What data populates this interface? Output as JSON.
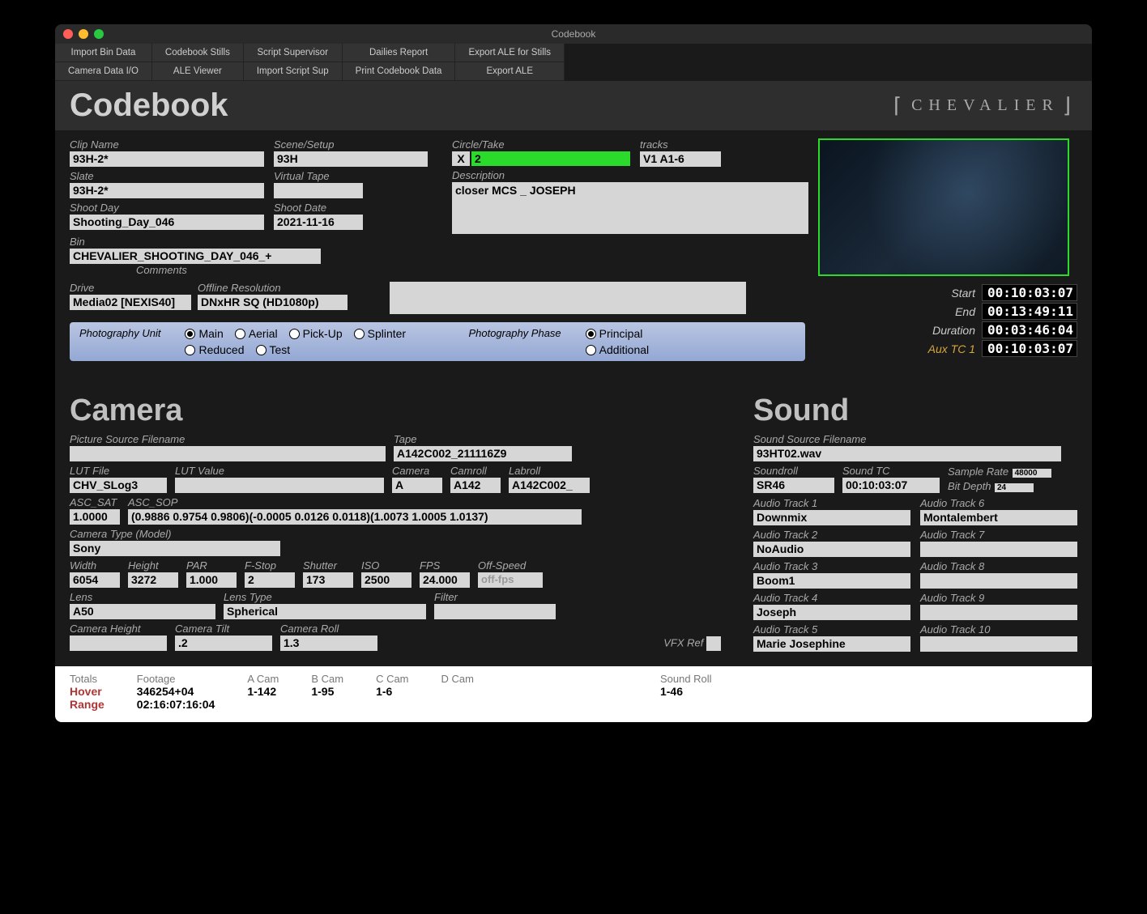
{
  "window": {
    "title": "Codebook"
  },
  "toolbar": {
    "r1c1": "Import Bin Data",
    "r2c1": "Camera Data I/O",
    "r1c2": "Codebook Stills",
    "r2c2": "ALE Viewer",
    "r1c3": "Script Supervisor",
    "r2c3": "Import Script Sup",
    "r1c4": "Dailies Report",
    "r2c4": "Print Codebook Data",
    "r1c5": "Export ALE for Stills",
    "r2c5": "Export ALE"
  },
  "header": {
    "title": "Codebook",
    "brand": "CHEVALIER"
  },
  "clip": {
    "clip_name_lbl": "Clip Name",
    "clip_name": "93H-2*",
    "slate_lbl": "Slate",
    "slate": "93H-2*",
    "shoot_day_lbl": "Shoot Day",
    "shoot_day": "Shooting_Day_046",
    "bin_lbl": "Bin",
    "bin": "CHEVALIER_SHOOTING_DAY_046_+",
    "drive_lbl": "Drive",
    "drive": "Media02 [NEXIS40]",
    "offline_res_lbl": "Offline Resolution",
    "offline_res": "DNxHR SQ (HD1080p)",
    "scene_lbl": "Scene/Setup",
    "scene": "93H",
    "vtape_lbl": "Virtual Tape",
    "vtape": "",
    "shoot_date_lbl": "Shoot Date",
    "shoot_date": "2021-11-16",
    "circle_lbl": "Circle/Take",
    "circle_x": "X",
    "circle_take": "2",
    "desc_lbl": "Description",
    "desc": "closer MCS _ JOSEPH",
    "comments_lbl": "Comments",
    "tracks_lbl": "tracks",
    "tracks": "V1 A1-6"
  },
  "radios": {
    "unit_lbl": "Photography Unit",
    "main": "Main",
    "aerial": "Aerial",
    "pickup": "Pick-Up",
    "splinter": "Splinter",
    "reduced": "Reduced",
    "test": "Test",
    "phase_lbl": "Photography Phase",
    "principal": "Principal",
    "additional": "Additional"
  },
  "tc": {
    "start_lbl": "Start",
    "start": "00:10:03:07",
    "end_lbl": "End",
    "end": "00:13:49:11",
    "dur_lbl": "Duration",
    "dur": "00:03:46:04",
    "aux_lbl": "Aux TC 1",
    "aux": "00:10:03:07"
  },
  "camera": {
    "title": "Camera",
    "psf_lbl": "Picture Source Filename",
    "psf": "",
    "lut_lbl": "LUT File",
    "lut": "CHV_SLog3",
    "lutv_lbl": "LUT Value",
    "lutv": "",
    "asat_lbl": "ASC_SAT",
    "asat": "1.0000",
    "asop_lbl": "ASC_SOP",
    "asop": "(0.9886 0.9754 0.9806)(-0.0005 0.0126 0.0118)(1.0073 1.0005 1.0137)",
    "tape_lbl": "Tape",
    "tape": "A142C002_211116Z9",
    "cam_lbl": "Camera",
    "cam": "A",
    "camroll_lbl": "Camroll",
    "camroll": "A142",
    "labroll_lbl": "Labroll",
    "labroll": "A142C002_",
    "type_lbl": "Camera Type (Model)",
    "type": "Sony",
    "w_lbl": "Width",
    "w": "6054",
    "h_lbl": "Height",
    "h": "3272",
    "par_lbl": "PAR",
    "par": "1.000",
    "fstop_lbl": "F-Stop",
    "fstop": "2",
    "shutter_lbl": "Shutter",
    "shutter": "173",
    "iso_lbl": "ISO",
    "iso": "2500",
    "fps_lbl": "FPS",
    "fps": "24.000",
    "off_lbl": "Off-Speed",
    "off": "off-fps",
    "lens_lbl": "Lens",
    "lens": "A50",
    "lenstype_lbl": "Lens Type",
    "lenstype": "Spherical",
    "filter_lbl": "Filter",
    "filter": "",
    "cheight_lbl": "Camera Height",
    "cheight": "",
    "ctilt_lbl": "Camera Tilt",
    "ctilt": ".2",
    "croll_lbl": "Camera Roll",
    "croll": "1.3",
    "vfx_lbl": "VFX Ref"
  },
  "sound": {
    "title": "Sound",
    "ssf_lbl": "Sound Source Filename",
    "ssf": "93HT02.wav",
    "sroll_lbl": "Soundroll",
    "sroll": "SR46",
    "stc_lbl": "Sound TC",
    "stc": "00:10:03:07",
    "srate_lbl": "Sample Rate",
    "srate": "48000",
    "bdepth_lbl": "Bit Depth",
    "bdepth": "24",
    "t1_lbl": "Audio Track 1",
    "t1": "Downmix",
    "t2_lbl": "Audio Track 2",
    "t2": "NoAudio",
    "t3_lbl": "Audio Track 3",
    "t3": "Boom1",
    "t4_lbl": "Audio Track 4",
    "t4": "Joseph",
    "t5_lbl": "Audio Track 5",
    "t5": "Marie Josephine",
    "t6_lbl": "Audio Track 6",
    "t6": "Montalembert",
    "t7_lbl": "Audio Track 7",
    "t7": "",
    "t8_lbl": "Audio Track 8",
    "t8": "",
    "t9_lbl": "Audio Track 9",
    "t9": "",
    "t10_lbl": "Audio Track 10",
    "t10": ""
  },
  "footer": {
    "totals_lbl": "Totals",
    "hover": "Hover",
    "range": "Range",
    "footage_lbl": "Footage",
    "footage1": "346254+04",
    "footage2": "02:16:07:16:04",
    "acam_lbl": "A Cam",
    "acam": "1-142",
    "bcam_lbl": "B Cam",
    "bcam": "1-95",
    "ccam_lbl": "C Cam",
    "ccam": "1-6",
    "dcam_lbl": "D Cam",
    "sroll_lbl": "Sound Roll",
    "sroll": "1-46"
  }
}
